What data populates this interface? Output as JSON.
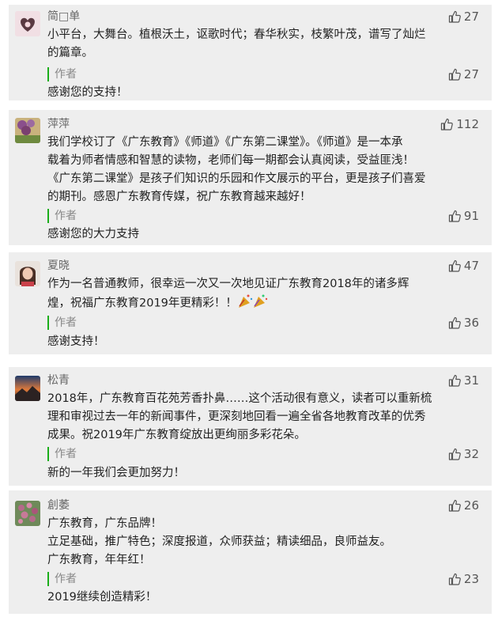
{
  "comments": [
    {
      "nickname": "简□单",
      "likes": "27",
      "text": "小平台，大舞台。植根沃土，讴歌时代；春华秋实，枝繁叶茂，谱写了灿烂\n的篇章。",
      "author_label": "作者",
      "reply_likes": "27",
      "reply": "感谢您的支持！"
    },
    {
      "nickname": "萍萍",
      "likes": "112",
      "text": "我们学校订了《广东教育》《师道》《广东第二课堂》。《师道》是一本承\n载着为师者情感和智慧的读物，老师们每一期都会认真阅读，受益匪浅！\n《广东第二课堂》是孩子们知识的乐园和作文展示的平台，更是孩子们喜爱\n的期刊。感恩广东教育传媒，祝广东教育越来越好！",
      "author_label": "作者",
      "reply_likes": "91",
      "reply": "感谢您的大力支持"
    },
    {
      "nickname": "夏晓",
      "likes": "47",
      "text": "作为一名普通教师，很幸运一次又一次地见证广东教育2018年的诸多辉\n煌，祝福广东教育2019年更精彩！！",
      "author_label": "作者",
      "reply_likes": "36",
      "reply": "感谢支持！"
    },
    {
      "nickname": "松青",
      "likes": "31",
      "text": "2018年，广东教育百花苑芳香扑鼻……这个活动很有意义，读者可以重新梳\n理和审视过去一年的新闻事件，更深刻地回看一遍全省各地教育改革的优秀\n成果。祝2019年广东教育绽放出更绚丽多彩花朵。",
      "author_label": "作者",
      "reply_likes": "32",
      "reply": "新的一年我们会更加努力！"
    },
    {
      "nickname": "創萎",
      "likes": "26",
      "text": "广东教育，广东品牌！\n立足基础，推广特色；深度报道，众师获益；精读细品，良师益友。\n广东教育，年年红！",
      "author_label": "作者",
      "reply_likes": "23",
      "reply": "2019继续创造精彩！"
    }
  ]
}
